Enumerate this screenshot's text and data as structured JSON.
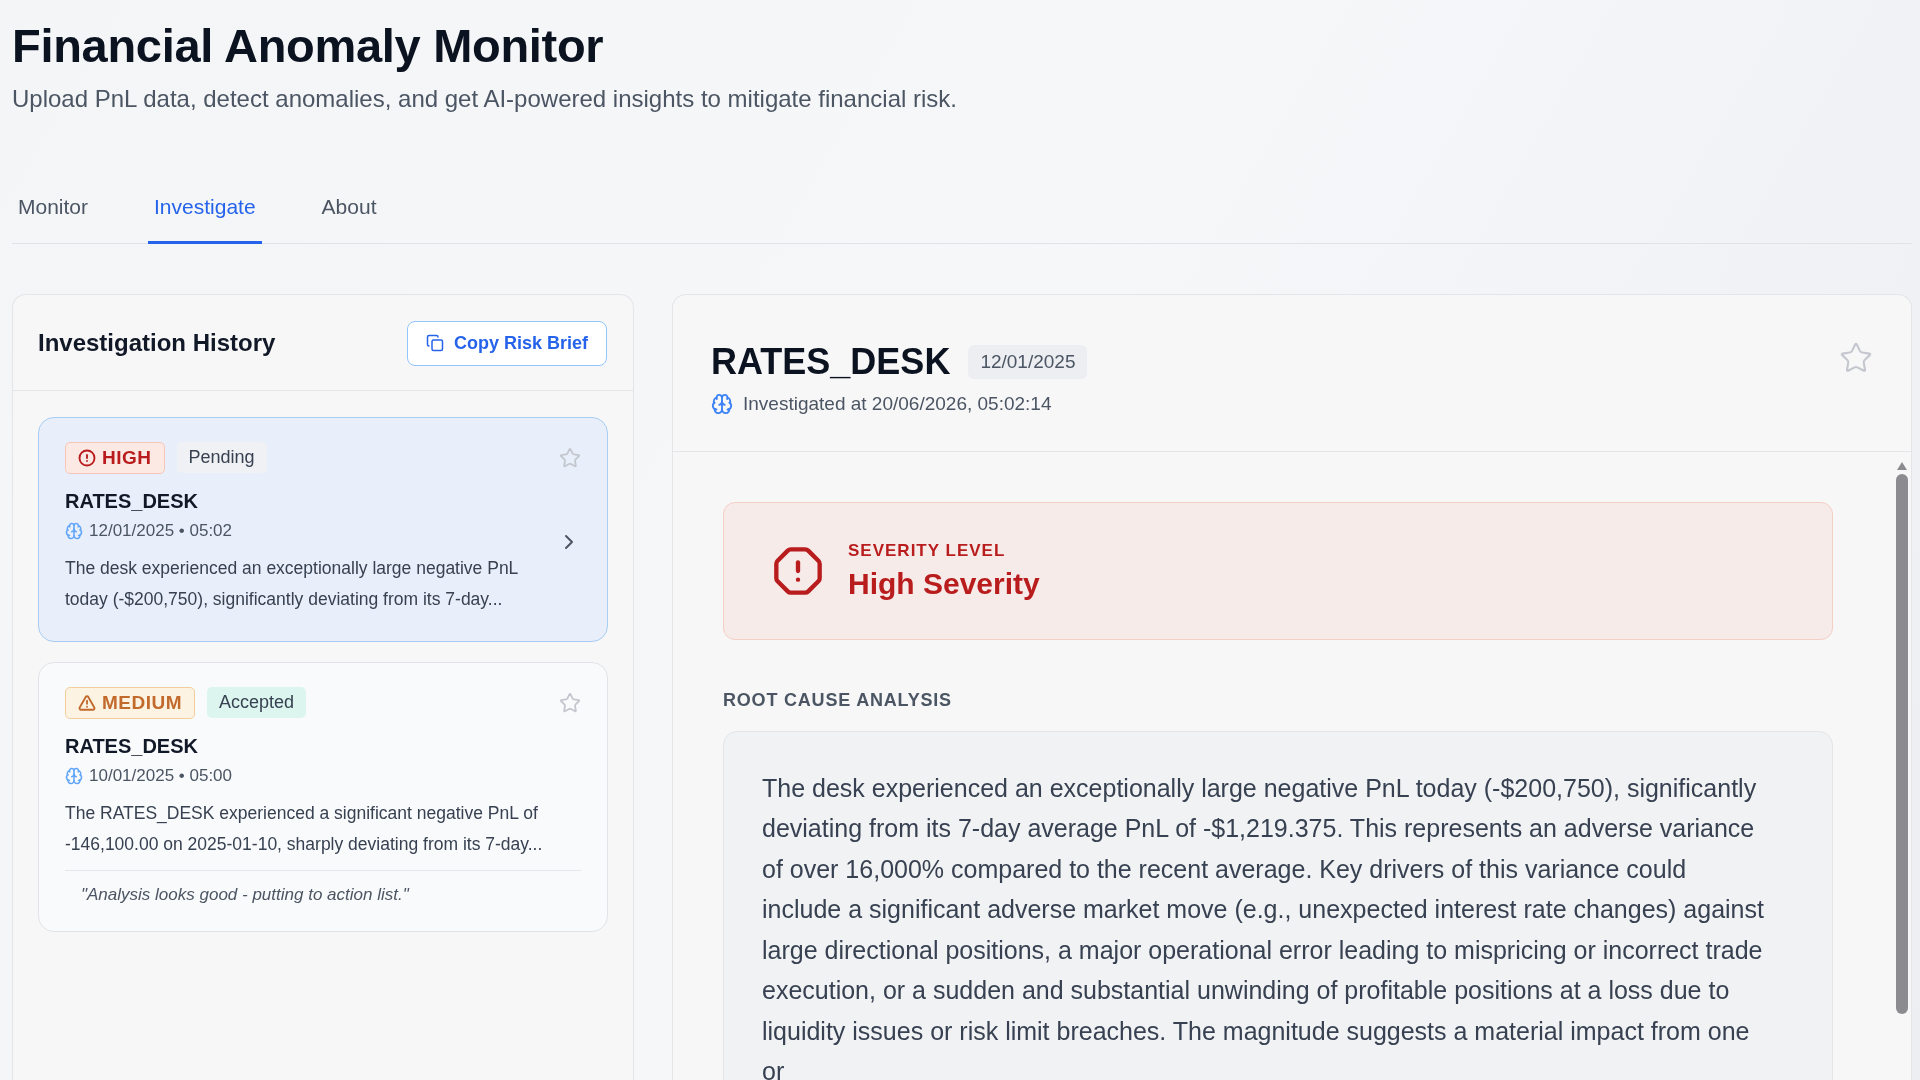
{
  "header": {
    "title": "Financial Anomaly Monitor",
    "subtitle": "Upload PnL data, detect anomalies, and get AI-powered insights to mitigate financial risk."
  },
  "tabs": [
    {
      "label": "Monitor",
      "selected": false
    },
    {
      "label": "Investigate",
      "selected": true
    },
    {
      "label": "About",
      "selected": false
    }
  ],
  "history": {
    "title": "Investigation History",
    "copy_button": "Copy Risk Brief",
    "items": [
      {
        "severity": {
          "kind": "high",
          "label": "HIGH"
        },
        "status": {
          "kind": "pending",
          "label": "Pending"
        },
        "starred": false,
        "selected": true,
        "desk": "RATES_DESK",
        "timestamp": "12/01/2025 • 05:02",
        "summary": "The desk experienced an exceptionally large negative PnL today (-$200,750), significantly deviating from its 7-day..."
      },
      {
        "severity": {
          "kind": "medium",
          "label": "MEDIUM"
        },
        "status": {
          "kind": "accepted",
          "label": "Accepted"
        },
        "starred": false,
        "selected": false,
        "desk": "RATES_DESK",
        "timestamp": "10/01/2025 • 05:00",
        "summary": "The RATES_DESK experienced a significant negative PnL of -146,100.00 on 2025-01-10, sharply deviating from its 7-day...",
        "note": "\"Analysis looks good - putting to action list.\""
      }
    ]
  },
  "detail": {
    "desk": "RATES_DESK",
    "date": "12/01/2025",
    "investigated": "Investigated at 20/06/2026, 05:02:14",
    "starred": false,
    "severity": {
      "kind": "high",
      "caption": "SEVERITY LEVEL",
      "label": "High Severity"
    },
    "root_cause": {
      "heading": "ROOT CAUSE ANALYSIS",
      "text": "The desk experienced an exceptionally large negative PnL today (-$200,750), significantly deviating from its 7-day average PnL of -$1,219.375. This represents an adverse variance of over 16,000% compared to the recent average. Key drivers of this variance could include a significant adverse market move (e.g., unexpected interest rate changes) against large directional positions, a major operational error leading to mispricing or incorrect trade execution, or a sudden and substantial unwinding of profitable positions at a loss due to liquidity issues or risk limit breaches. The magnitude suggests a material impact from one or"
    }
  }
}
